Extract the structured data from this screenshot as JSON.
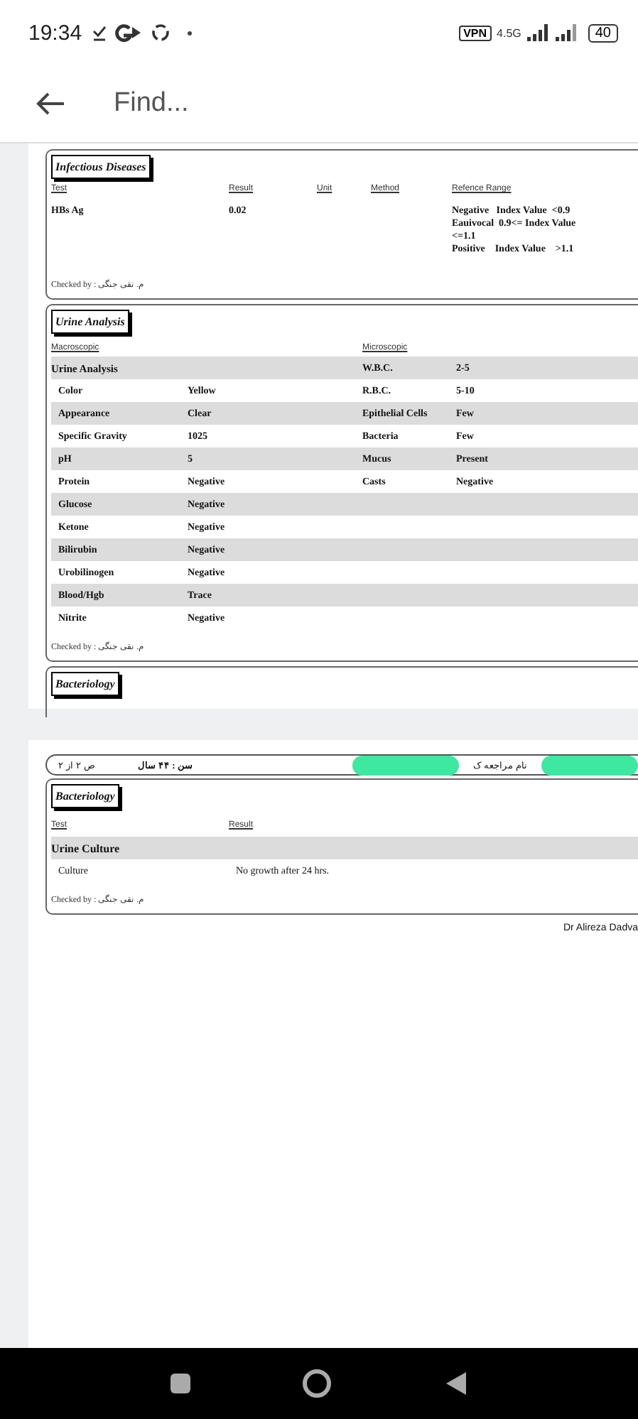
{
  "status_bar": {
    "time": "19:34",
    "vpn": "VPN",
    "network": "4.5G",
    "battery": "40"
  },
  "toolbar": {
    "placeholder": "Find..."
  },
  "page_1": {
    "infectious": {
      "title": "Infectious Diseases",
      "columns": [
        "Test",
        "Result",
        "Unit",
        "Method",
        "Refence Range"
      ],
      "rows": [
        {
          "test": "HBs Ag",
          "result": "0.02",
          "reference": [
            "Negative   Index Value  <0.9",
            "Eauivocal  0.9<= Index Value",
            "<=1.1",
            "Positive    Index Value    >1.1"
          ]
        }
      ],
      "checked_by": "Checked by : م. نقی جنگی"
    },
    "urine": {
      "title": "Urine Analysis",
      "headers": [
        "Macroscopic",
        "Microscopic"
      ],
      "macroscopic": [
        {
          "kind": "heading",
          "name": "Urine Analysis"
        },
        {
          "kind": "item",
          "name": "Color",
          "value": "Yellow"
        },
        {
          "kind": "item",
          "name": "Appearance",
          "value": "Clear"
        },
        {
          "kind": "item",
          "name": "Specific Gravity",
          "value": "1025"
        },
        {
          "kind": "item",
          "name": "pH",
          "value": "5"
        },
        {
          "kind": "item",
          "name": "Protein",
          "value": "Negative"
        },
        {
          "kind": "item",
          "name": "Glucose",
          "value": "Negative"
        },
        {
          "kind": "item",
          "name": "Ketone",
          "value": "Negative"
        },
        {
          "kind": "item",
          "name": "Bilirubin",
          "value": "Negative"
        },
        {
          "kind": "item",
          "name": "Urobilinogen",
          "value": "Negative"
        },
        {
          "kind": "item",
          "name": "Blood/Hgb",
          "value": "Trace"
        },
        {
          "kind": "item",
          "name": "Nitrite",
          "value": "Negative"
        }
      ],
      "microscopic": [
        {
          "name": "W.B.C.",
          "value": "2-5"
        },
        {
          "name": "R.B.C.",
          "value": "5-10"
        },
        {
          "name": "Epithelial Cells",
          "value": "Few"
        },
        {
          "name": "Bacteria",
          "value": "Few"
        },
        {
          "name": "Mucus",
          "value": "Present"
        },
        {
          "name": "Casts",
          "value": "Negative"
        }
      ],
      "checked_by": "Checked by : م. نقی جنگی"
    },
    "bacteriology_title": "Bacteriology"
  },
  "page_2": {
    "header": {
      "page": "ص ۲ از ۲",
      "age": "سن : ۴۴ سال",
      "name_label": "نام مراجعه ک"
    },
    "bacteriology": {
      "title": "Bacteriology",
      "columns": [
        "Test",
        "Result"
      ],
      "heading": "Urine  Culture",
      "rows": [
        {
          "test": "Culture",
          "result": "No growth after 24 hrs."
        }
      ],
      "checked_by": "Checked by : م. نقی جنگی"
    },
    "signature": "Dr Alireza Dadva"
  }
}
